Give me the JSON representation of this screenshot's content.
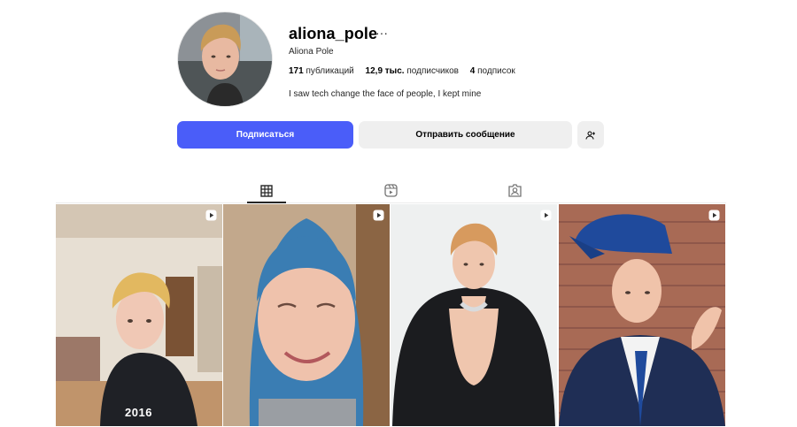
{
  "profile": {
    "username": "aliona_pole",
    "more_label": "···",
    "full_name": "Aliona Pole",
    "stats": {
      "posts_count": "171",
      "posts_label": "публикаций",
      "followers_count": "12,9 тыс.",
      "followers_label": "подписчиков",
      "following_count": "4",
      "following_label": "подписок"
    },
    "bio": "I saw tech change the face of people, I kept mine"
  },
  "actions": {
    "follow_label": "Подписаться",
    "message_label": "Отправить сообщение",
    "suggest_icon": "add-person-icon"
  },
  "tabs": [
    {
      "icon": "grid-icon",
      "active": true
    },
    {
      "icon": "reels-icon",
      "active": false
    },
    {
      "icon": "tagged-icon",
      "active": false
    }
  ],
  "posts": [
    {
      "type": "reel",
      "caption": "2016"
    },
    {
      "type": "reel",
      "caption": ""
    },
    {
      "type": "reel",
      "caption": ""
    },
    {
      "type": "reel",
      "caption": ""
    }
  ],
  "colors": {
    "primary_button": "#4a5df9",
    "secondary_button": "#efefef"
  }
}
